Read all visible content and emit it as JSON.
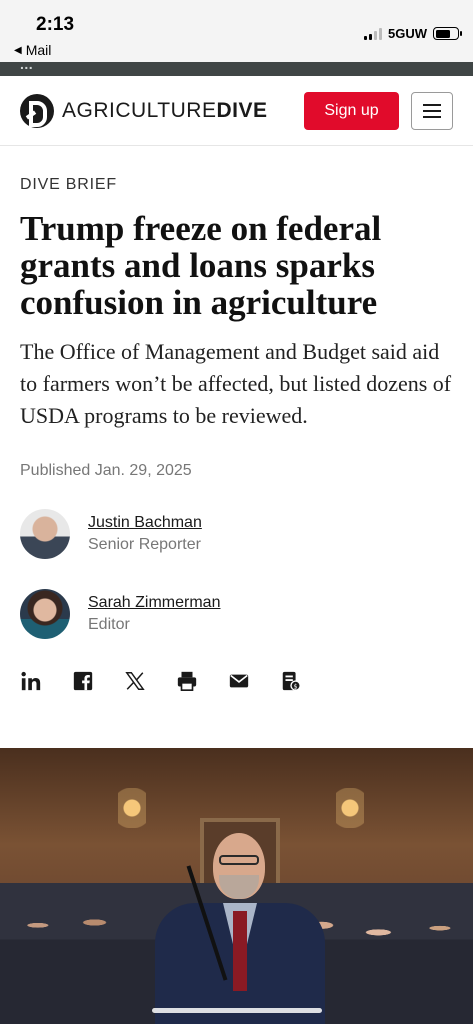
{
  "status_bar": {
    "time": "2:13",
    "back_label": "Mail",
    "network": "5GUW"
  },
  "top_strip": {
    "text": "..."
  },
  "header": {
    "logo_light": "AGRICULTURE",
    "logo_bold": "DIVE",
    "signup_label": "Sign up",
    "accent_color": "#e10b2b"
  },
  "article": {
    "kicker": "DIVE BRIEF",
    "headline": "Trump freeze on federal grants and loans sparks confusion in agriculture",
    "dek": "The Office of Management and Budget said aid to farmers won’t be affected, but listed dozens of USDA programs to be reviewed.",
    "published": "Published Jan. 29, 2025",
    "authors": [
      {
        "name": "Justin Bachman",
        "role": "Senior Reporter"
      },
      {
        "name": "Sarah Zimmerman",
        "role": "Editor"
      }
    ]
  },
  "share_icons": [
    "linkedin-icon",
    "facebook-icon",
    "x-icon",
    "print-icon",
    "email-icon",
    "newsletter-icon"
  ]
}
